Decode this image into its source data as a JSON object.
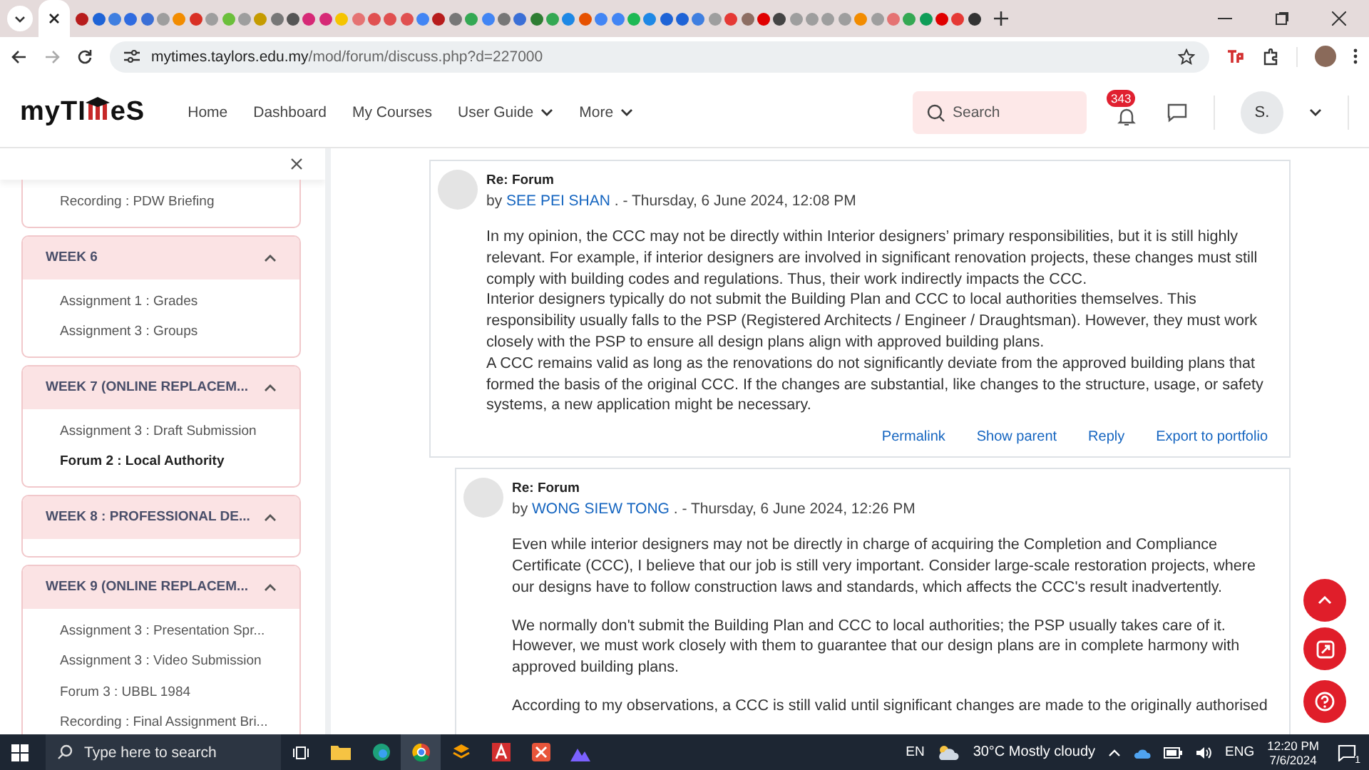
{
  "browser": {
    "url_host": "mytimes.taylors.edu.my",
    "url_path": "/mod/forum/discuss.php?d=227000"
  },
  "site": {
    "nav": [
      {
        "label": "Home",
        "dropdown": false
      },
      {
        "label": "Dashboard",
        "dropdown": false
      },
      {
        "label": "My Courses",
        "dropdown": false
      },
      {
        "label": "User Guide",
        "dropdown": true
      },
      {
        "label": "More",
        "dropdown": true
      }
    ],
    "logo_parts": [
      "myTI",
      "eS"
    ],
    "search_placeholder": "Search",
    "notification_count": "343",
    "avatar_initials": "S."
  },
  "sidebar": {
    "sections": [
      {
        "items": [
          {
            "label": "Recording : PDW Briefing",
            "current": false
          }
        ]
      },
      {
        "title": "WEEK 6",
        "expanded": true,
        "items": [
          {
            "label": "Assignment 1 : Grades",
            "current": false
          },
          {
            "label": "Assignment 3 : Groups",
            "current": false
          }
        ]
      },
      {
        "title": "WEEK 7 (ONLINE REPLACEM...",
        "expanded": true,
        "items": [
          {
            "label": "Assignment 3 : Draft Submission",
            "current": false
          },
          {
            "label": "Forum 2 : Local Authority",
            "current": true
          }
        ]
      },
      {
        "title": "WEEK 8 : PROFESSIONAL DE...",
        "expanded": true
      },
      {
        "title": "WEEK 9 (ONLINE REPLACEM...",
        "expanded": true,
        "items": [
          {
            "label": "Assignment 3 : Presentation Spr...",
            "current": false
          },
          {
            "label": "Assignment 3 : Video Submission",
            "current": false
          },
          {
            "label": "Forum 3 : UBBL 1984",
            "current": false
          },
          {
            "label": "Recording : Final Assignment Bri...",
            "current": false
          }
        ]
      }
    ]
  },
  "posts": [
    {
      "subject": "Re: Forum",
      "by_label": "by",
      "author": "SEE PEI SHAN",
      "date": ". - Thursday, 6 June 2024, 12:08 PM",
      "spaced": false,
      "paragraphs": [
        "In my opinion, the CCC may not be directly within Interior designers’ primary responsibilities, but it is still highly relevant. For example, if interior designers are involved in significant renovation projects, these changes must still comply with building codes and regulations. Thus, their work indirectly impacts the CCC.",
        "Interior designers typically do not submit the Building Plan and CCC to local authorities themselves. This responsibility usually falls to the PSP (Registered Architects / Engineer / Draughtsman). However, they must work closely with the PSP to ensure all design plans align with approved building plans.",
        "A CCC remains valid as long as the renovations do not significantly deviate from the approved building plans that formed the basis of the original CCC. If the changes are substantial, like changes to the structure, usage, or safety systems, a new application might be necessary."
      ],
      "actions": [
        "Permalink",
        "Show parent",
        "Reply",
        "Export to portfolio"
      ]
    },
    {
      "subject": "Re: Forum",
      "by_label": "by",
      "author": "WONG SIEW TONG",
      "date": ". - Thursday, 6 June 2024, 12:26 PM",
      "spaced": true,
      "paragraphs": [
        "Even while interior designers may not be directly in charge of acquiring the Completion and Compliance Certificate (CCC), I believe that our job is still very important. Consider large-scale restoration projects, where our designs have to follow construction laws and standards, which affects the CCC's result inadvertently.",
        "We normally don't submit the Building Plan and CCC to local authorities; the PSP usually takes care of it. However, we must work closely with them to guarantee that our design plans are in complete harmony with approved building plans.",
        "According to my observations, a CCC is still valid until significant changes are made to the originally authorised"
      ]
    }
  ],
  "taskbar": {
    "search_placeholder": "Type here to search",
    "language_short": "EN",
    "weather": "30°C Mostly cloudy",
    "language": "ENG",
    "time": "12:20 PM",
    "date": "7/6/2024",
    "notification_count": "1"
  }
}
